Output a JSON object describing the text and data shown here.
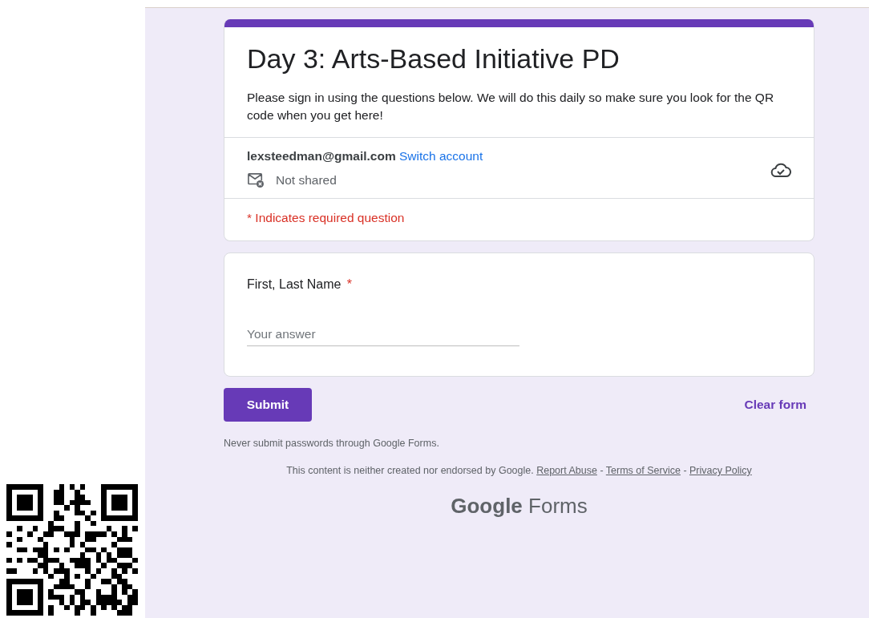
{
  "header": {
    "title": "Day 3: Arts-Based Initiative PD",
    "description": "Please sign in using the questions below. We will do this daily so make sure you look for the QR code when you get here!"
  },
  "account": {
    "email": "lexsteedman@gmail.com",
    "switch_link": "Switch account",
    "sharing": "Not shared"
  },
  "required_note": "* Indicates required question",
  "questions": [
    {
      "label": "First, Last Name",
      "required_mark": "*",
      "placeholder": "Your answer"
    }
  ],
  "actions": {
    "submit": "Submit",
    "clear": "Clear form"
  },
  "password_warning": "Never submit passwords through Google Forms.",
  "footer": {
    "disclaimer": "This content is neither created nor endorsed by Google.",
    "links": [
      "Report Abuse",
      "Terms of Service",
      "Privacy Policy"
    ],
    "separator": "-",
    "logo": "**Google** Forms"
  }
}
